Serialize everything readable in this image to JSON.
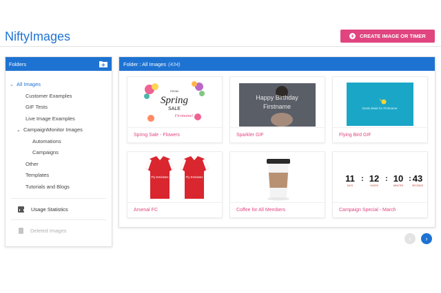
{
  "app": {
    "title": "NiftyImages"
  },
  "header": {
    "create_label": "CREATE IMAGE OR TIMER"
  },
  "sidebar": {
    "title": "Folders",
    "tree": {
      "all_images": "All Images",
      "customer_examples": "Customer Examples",
      "gif_tests": "GIF Tests",
      "live_image_examples": "Live Image Examples",
      "campaignmonitor_images": "CampaignMonitor Images",
      "automations": "Automations",
      "campaigns": "Campaigns",
      "other": "Other",
      "templates": "Templates",
      "tutorials_and_blogs": "Tutorials and Blogs"
    },
    "usage_statistics": "Usage Statistics",
    "deleted_images": "Deleted Images"
  },
  "panel": {
    "title": "Folder : All Images",
    "count": "(434)"
  },
  "images": [
    {
      "caption": "Spring Sale - Flowers",
      "thumb": {
        "line1": "FROM",
        "line2": "Spring",
        "line3": "SALE",
        "line4": "Firstname!"
      }
    },
    {
      "caption": "Sparkler GIF",
      "thumb": {
        "line1": "Happy Birthday",
        "line2": "Firstname"
      }
    },
    {
      "caption": "Flying Bird GIF",
      "thumb": {
        "line1": "Great deals for Firstname"
      }
    },
    {
      "caption": "Arsenal FC",
      "thumb": {
        "line1": "Fly Emirates",
        "line2": "Fly Emirates"
      }
    },
    {
      "caption": "Coffee for All Members",
      "thumb": {}
    },
    {
      "caption": "Campaign Special - March",
      "thumb": {
        "days": "11",
        "hours": "12",
        "minutes": "10",
        "seconds": "43",
        "days_label": "DAYS",
        "hours_label": "HOURS",
        "minutes_label": "MINUTES",
        "seconds_label": "SECONDS",
        "sep": ":"
      }
    }
  ],
  "pager": {
    "prev": "‹",
    "next": "›"
  },
  "colors": {
    "brand_blue": "#1e73d2",
    "accent_pink": "#e0457f"
  }
}
